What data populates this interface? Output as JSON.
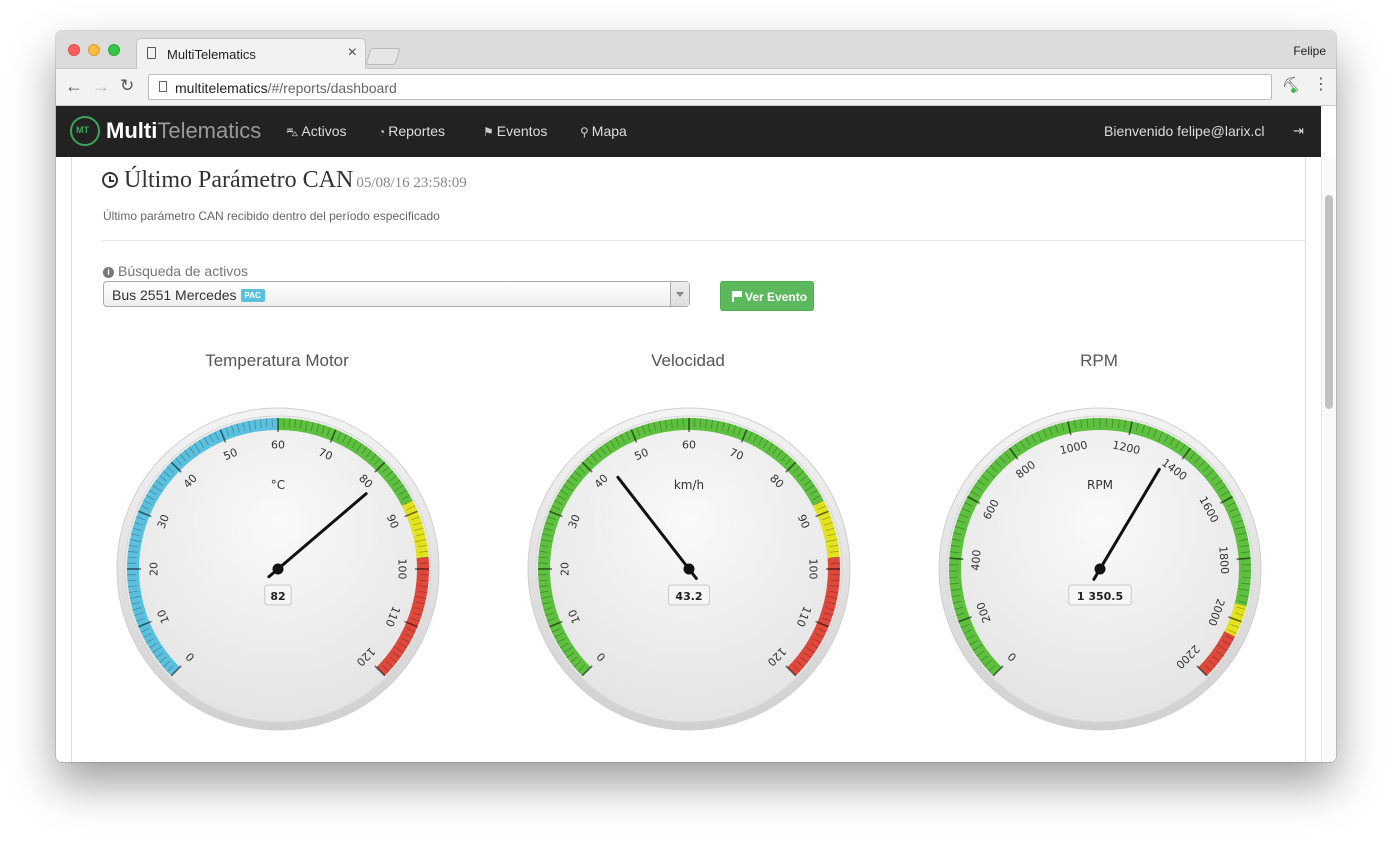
{
  "browser": {
    "tab_title": "MultiTelematics",
    "tab_close": "×",
    "profile_name": "Felipe",
    "url_host": "multitelematics",
    "url_path": "/#/reports/dashboard",
    "back": "←",
    "forward": "→",
    "reload": "↻",
    "menu": "⋮",
    "extension_glyph": "⛏"
  },
  "navbar": {
    "brand_bold": "Multi",
    "brand_light": "Telematics",
    "logo_text": "MT",
    "items": [
      {
        "label": "Activos",
        "icon": "car-icon",
        "glyph": "⛍"
      },
      {
        "label": "Reportes",
        "icon": "dashboard-icon",
        "glyph": "◔"
      },
      {
        "label": "Eventos",
        "icon": "flag-icon",
        "glyph": "⚑"
      },
      {
        "label": "Mapa",
        "icon": "map-marker-icon",
        "glyph": "⚲"
      }
    ],
    "welcome": "Bienvenido felipe@larix.cl",
    "logout_glyph": "⇥"
  },
  "header": {
    "title": "Último Parámetro CAN",
    "timestamp": "05/08/16 23:58:09",
    "subtitle": "Último parámetro CAN recibido dentro del período especificado"
  },
  "search": {
    "label": "Búsqueda de activos",
    "info_glyph": "i",
    "selected": "Bus 2551 Mercedes",
    "badge": "PAC",
    "button": "Ver Evento"
  },
  "colors": {
    "blue": "#5bc0de",
    "green": "#5dc03f",
    "yellow": "#e2e21e",
    "red": "#e0483c"
  },
  "gauges": [
    {
      "title": "Temperatura Motor",
      "unit": "°C",
      "display": "82",
      "value": 82,
      "min": 0,
      "max": 120,
      "major_step": 10,
      "labels": [
        "0",
        "10",
        "20",
        "30",
        "40",
        "50",
        "60",
        "70",
        "80",
        "90",
        "100",
        "110",
        "120"
      ],
      "zones": [
        {
          "from": 0,
          "to": 60,
          "color": "blue"
        },
        {
          "from": 60,
          "to": 88,
          "color": "green"
        },
        {
          "from": 88,
          "to": 98,
          "color": "yellow"
        },
        {
          "from": 98,
          "to": 120,
          "color": "red"
        }
      ]
    },
    {
      "title": "Velocidad",
      "unit": "km/h",
      "display": "43.2",
      "value": 43.2,
      "min": 0,
      "max": 120,
      "major_step": 10,
      "labels": [
        "0",
        "10",
        "20",
        "30",
        "40",
        "50",
        "60",
        "70",
        "80",
        "90",
        "100",
        "110",
        "120"
      ],
      "zones": [
        {
          "from": 0,
          "to": 88,
          "color": "green"
        },
        {
          "from": 88,
          "to": 98,
          "color": "yellow"
        },
        {
          "from": 98,
          "to": 120,
          "color": "red"
        }
      ]
    },
    {
      "title": "RPM",
      "unit": "RPM",
      "display": "1 350.5",
      "value": 1350.5,
      "min": 0,
      "max": 2200,
      "major_step": 200,
      "labels": [
        "0",
        "200",
        "400",
        "600",
        "800",
        "1000",
        "1200",
        "1400",
        "1600",
        "1800",
        "2000",
        "2200"
      ],
      "zones": [
        {
          "from": 0,
          "to": 1950,
          "color": "green"
        },
        {
          "from": 1950,
          "to": 2050,
          "color": "yellow"
        },
        {
          "from": 2050,
          "to": 2200,
          "color": "red"
        }
      ]
    }
  ]
}
